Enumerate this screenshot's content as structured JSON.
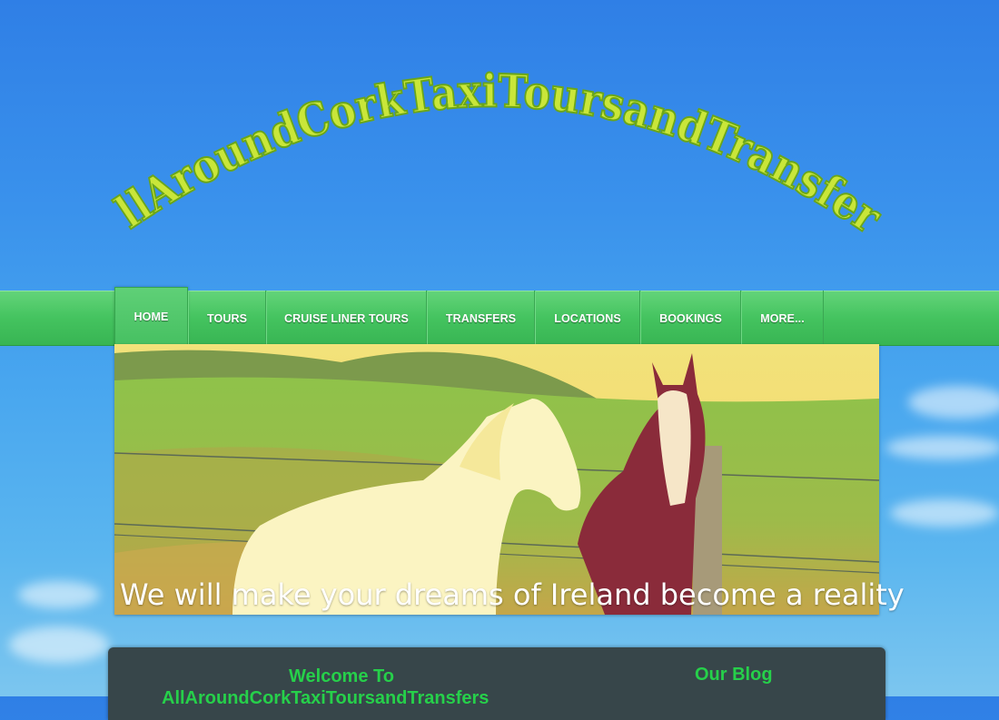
{
  "site": {
    "logo_text": "AllAroundCorkTaxiToursandTransfers"
  },
  "nav": {
    "items": [
      {
        "label": "HOME",
        "active": true
      },
      {
        "label": "TOURS"
      },
      {
        "label": "CRUISE LINER TOURS"
      },
      {
        "label": "TRANSFERS"
      },
      {
        "label": "LOCATIONS"
      },
      {
        "label": "BOOKINGS"
      },
      {
        "label": "MORE..."
      }
    ]
  },
  "hero": {
    "caption": "We will make your dreams of Ireland become a reality"
  },
  "content": {
    "welcome_heading": "Welcome To",
    "welcome_subheading": "AllAroundCorkTaxiToursandTransfers",
    "blog_heading": "Our Blog"
  },
  "colors": {
    "sky": "#3a92ec",
    "nav_green": "#44c35f",
    "heading_green": "#26d04a",
    "logo_fill": "#c9e639",
    "panel": "#37464a"
  }
}
